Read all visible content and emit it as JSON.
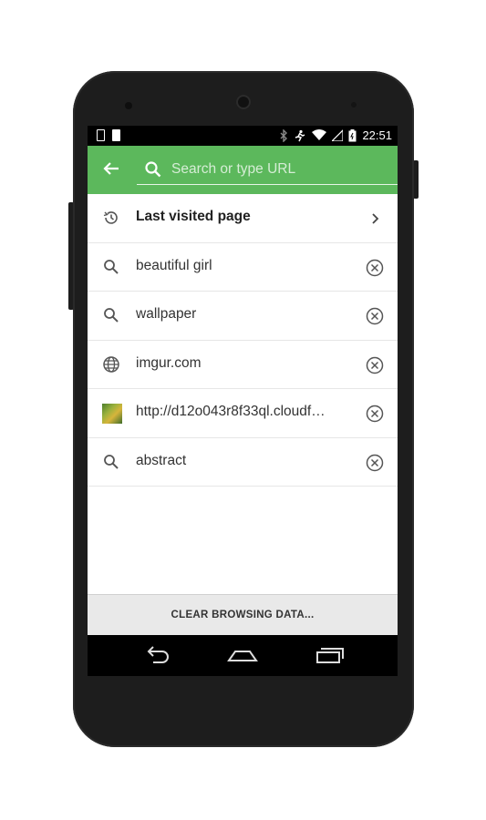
{
  "status_bar": {
    "time": "22:51"
  },
  "app_bar": {
    "search_placeholder": "Search or type URL"
  },
  "list": {
    "items": [
      {
        "label": "Last visited page",
        "icon": "history-icon",
        "trailing": "chevron-right-icon"
      },
      {
        "label": "beautiful girl",
        "icon": "search-icon",
        "trailing": "remove-icon"
      },
      {
        "label": "wallpaper",
        "icon": "search-icon",
        "trailing": "remove-icon"
      },
      {
        "label": "imgur.com",
        "icon": "globe-icon",
        "trailing": "remove-icon"
      },
      {
        "label": "http://d12o043r8f33ql.cloudf…",
        "icon": "site-thumbnail",
        "trailing": "remove-icon"
      },
      {
        "label": "abstract",
        "icon": "search-icon",
        "trailing": "remove-icon"
      }
    ]
  },
  "footer": {
    "clear_label": "CLEAR BROWSING DATA..."
  },
  "colors": {
    "accent": "#5cb85c",
    "statusbar": "#000000",
    "footer_bg": "#e9e9e9"
  }
}
